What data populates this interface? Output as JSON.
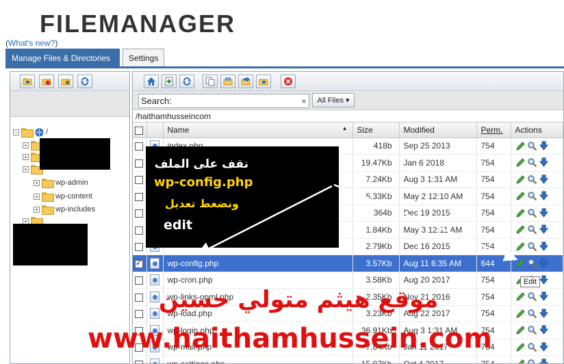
{
  "app": {
    "title": "FILEMANAGER",
    "whats_new_prefix": "(",
    "whats_new_link": "What's new?",
    "whats_new_suffix": ")"
  },
  "tabs": [
    {
      "label": "Manage Files & Directories",
      "active": true
    },
    {
      "label": "Settings",
      "active": false
    }
  ],
  "toolbar_left": {
    "icons": [
      "new-folder-icon",
      "delete-folder-icon",
      "folder-permissions-icon",
      "refresh-icon"
    ]
  },
  "toolbar_right": {
    "icons": [
      "home-icon",
      "add-file-icon",
      "refresh-icon",
      "copy-icon",
      "upload-icon",
      "move-icon",
      "rename-icon",
      "delete-icon"
    ]
  },
  "tree": {
    "root": "/",
    "items": [
      "wp-admin",
      "wp-content",
      "wp-includes"
    ]
  },
  "search": {
    "label": "Search:",
    "value": "",
    "clear": "×"
  },
  "filter": {
    "label": "All Files",
    "caret": "▾"
  },
  "path": "/haithamhusseincom",
  "table": {
    "headers": {
      "name": "Name",
      "size": "Size",
      "modified": "Modified",
      "perm": "Perm.",
      "actions": "Actions"
    },
    "rows": [
      {
        "name": "index.php",
        "size": "418b",
        "modified": "Sep 25 2013",
        "perm": "754",
        "selected": false
      },
      {
        "name": "",
        "size": "19.47Kb",
        "modified": "Jan 6 2018",
        "perm": "754",
        "selected": false
      },
      {
        "name": "",
        "size": "7.24Kb",
        "modified": "Aug 3 1:31 AM",
        "perm": "754",
        "selected": false
      },
      {
        "name": "",
        "size": "5.33Kb",
        "modified": "May 2 12:10 AM",
        "perm": "754",
        "selected": false
      },
      {
        "name": "",
        "size": "364b",
        "modified": "Dec 19 2015",
        "perm": "754",
        "selected": false
      },
      {
        "name": "",
        "size": "1.84Kb",
        "modified": "May 3 12:11 AM",
        "perm": "754",
        "selected": false
      },
      {
        "name": "",
        "size": "2.79Kb",
        "modified": "Dec 16 2015",
        "perm": "754",
        "selected": false
      },
      {
        "name": "wp-config.php",
        "size": "3.57Kb",
        "modified": "Aug 11 6:35 AM",
        "perm": "644",
        "selected": true
      },
      {
        "name": "wp-cron.php",
        "size": "3.58Kb",
        "modified": "Aug 20 2017",
        "perm": "754",
        "selected": false
      },
      {
        "name": "wp-links-opml.php",
        "size": "2.35Kb",
        "modified": "Nov 21 2016",
        "perm": "754",
        "selected": false
      },
      {
        "name": "wp-load.php",
        "size": "3.23Kb",
        "modified": "Aug 22 2017",
        "perm": "754",
        "selected": false
      },
      {
        "name": "wp-login.php",
        "size": "36.91Kb",
        "modified": "Aug 3 1:31 AM",
        "perm": "754",
        "selected": false
      },
      {
        "name": "wp-mail.php",
        "size": "7.84Kb",
        "modified": "Jan 11 2017",
        "perm": "754",
        "selected": false
      },
      {
        "name": "wp-settings.php",
        "size": "15.87Kb",
        "modified": "Oct 4 2017",
        "perm": "754",
        "selected": false
      }
    ]
  },
  "tooltip": "Edit",
  "callout": {
    "line1": "نقف على الملف",
    "line2": "wp-config.php",
    "line3": "ونضغط تعديل",
    "line4": "edit"
  },
  "watermark": {
    "arabic": "موقع هيثم متولي حسين",
    "url": "www.haithamhussein.com"
  },
  "colors": {
    "tab_active": "#3b6ea8",
    "selected_row": "#3d6fcf",
    "watermark": "#e01010",
    "callout_highlight": "#ffd600"
  }
}
